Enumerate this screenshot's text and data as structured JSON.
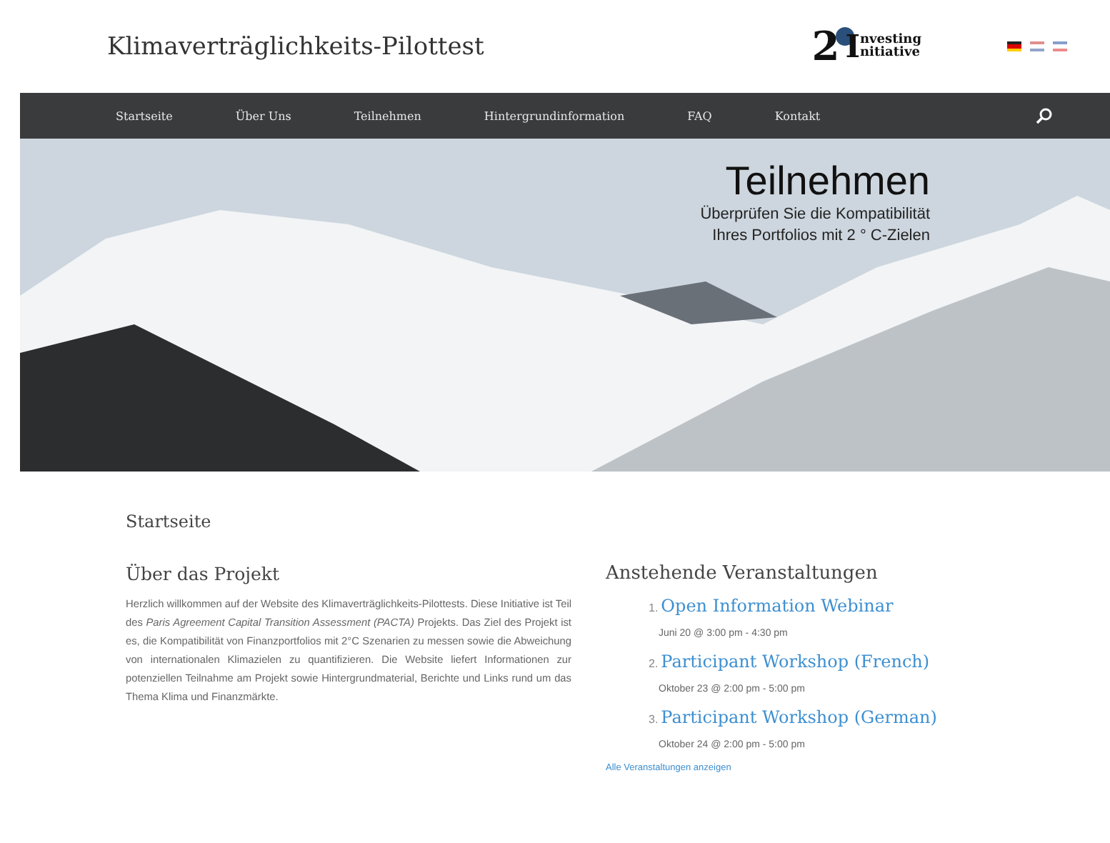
{
  "site_title": "Klimaverträglichkeits-Pilottest",
  "logo": {
    "mark": "2",
    "initial": "I",
    "line_1": "nvesting",
    "line_2": "nitiative"
  },
  "languages": [
    {
      "kind": "de",
      "selected": true
    },
    {
      "kind": "en",
      "selected": false
    },
    {
      "kind": "fr",
      "selected": false
    }
  ],
  "nav": [
    {
      "label": "Startseite"
    },
    {
      "label": "Über Uns"
    },
    {
      "label": "Teilnehmen"
    },
    {
      "label": "Hintergrundinformation"
    },
    {
      "label": "FAQ"
    },
    {
      "label": "Kontakt"
    }
  ],
  "hero": {
    "title": "Teilnehmen",
    "subtitle_1": "Überprüfen Sie die Kompatibilität",
    "subtitle_2": "Ihres Portfolios mit 2 ° C-Zielen"
  },
  "breadcrumb": "Startseite",
  "about": {
    "heading": "Über das Projekt",
    "text": "Herzlich willkommen auf der Website des Klimaverträglichkeits-Pilottests. Diese Initiative ist Teil des *Paris Agreement Capital Transition Assessment (PACTA)* Projekts. Das Ziel des Projekt ist es, die Kompatibilität von Finanzportfolios mit 2°C Szenarien zu messen sowie die Abweichung von internationalen Klimazielen zu quantifizieren. Die Website liefert Informationen zur potenziellen Teilnahme am Projekt sowie Hintergrundmaterial, Berichte und Links rund um das Thema Klima und Finanzmärkte."
  },
  "events": {
    "heading": "Anstehende Veranstaltungen",
    "items": [
      {
        "number": "1.",
        "title": "Open Information Webinar",
        "date": "Juni 20 @ 3:00 pm - 4:30 pm"
      },
      {
        "number": "2.",
        "title": "Participant Workshop (French)",
        "date": "Oktober 23 @ 2:00 pm - 5:00 pm"
      },
      {
        "number": "3.",
        "title": "Participant Workshop (German)",
        "date": "Oktober 24 @ 2:00 pm - 5:00 pm"
      }
    ],
    "all_link": "Alle Veranstaltungen anzeigen"
  }
}
